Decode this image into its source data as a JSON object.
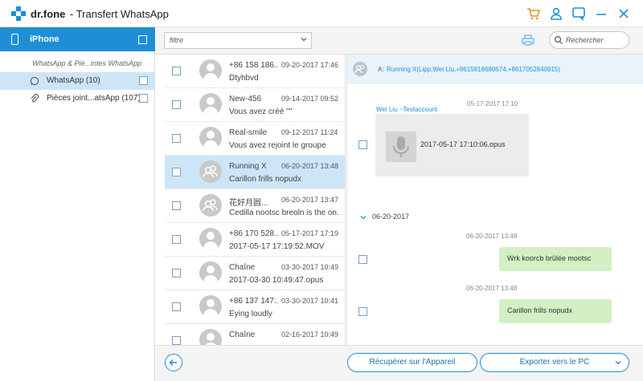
{
  "app": {
    "brand": "dr.fone",
    "title": "- Transfert WhatsApp"
  },
  "titlebar": {
    "icons": [
      "cart-icon",
      "user-icon",
      "feedback-icon",
      "minimize-icon",
      "close-icon"
    ]
  },
  "sidebar": {
    "device_name": "iPhone",
    "category_header": "WhatsApp & Piè...intes WhatsApp",
    "items": [
      {
        "label": "WhatsApp (10)",
        "icon": "whatsapp-icon",
        "selected": true
      },
      {
        "label": "Pièces joint...atsApp (107)",
        "icon": "paperclip-icon",
        "selected": false
      }
    ]
  },
  "toolbar": {
    "filter_value": "filtre",
    "search_placeholder": "Rechercher"
  },
  "conversations": [
    {
      "name": "+86 158 186...",
      "date": "09-20-2017 17:46",
      "preview": "Dtyhbvd",
      "selected": false,
      "group": false
    },
    {
      "name": "New-456",
      "date": "09-14-2017 09:52",
      "preview": "Vous avez créé \"\"",
      "selected": false,
      "group": false
    },
    {
      "name": "Real-smile",
      "date": "09-12-2017 11:24",
      "preview": "Vous avez rejoint le groupe",
      "selected": false,
      "group": false
    },
    {
      "name": "Running X",
      "date": "06-20-2017 13:48",
      "preview": "Carillon frills nopudx",
      "selected": true,
      "group": true
    },
    {
      "name": "花好月圆...",
      "date": "06-20-2017 13:47",
      "preview": "Cedilla nootsc breoln is the on...",
      "selected": false,
      "group": true
    },
    {
      "name": "+86 170 528...",
      "date": "05-17-2017 17:19",
      "preview": "2017-05-17 17:19:52.MOV",
      "selected": false,
      "group": false
    },
    {
      "name": "Chaîne",
      "date": "03-30-2017 10:49",
      "preview": "2017-03-30 10:49:47.opus",
      "selected": false,
      "group": false
    },
    {
      "name": "+86 137 147...",
      "date": "03-30-2017 10:41",
      "preview": "Eying loudly",
      "selected": false,
      "group": false
    },
    {
      "name": "Chaîne",
      "date": "02-16-2017 10:49",
      "preview": "",
      "selected": false,
      "group": false
    }
  ],
  "chat": {
    "to_label": "A:",
    "members": "Running X(Lipp,Wei Liu,+8615818680674,+8617052840915)",
    "first_time": "05-17-2017 17:10",
    "sender": "Wei Liu ~Testaccount",
    "attachment_name": "2017-05-17 17:10:06.opus",
    "date_separator": "06-20-2017",
    "messages": [
      {
        "time": "06-20-2017 13:48",
        "text": "Wrk koorcb brûlée mootsc"
      },
      {
        "time": "06-20-2017 13:48",
        "text": "Carillon frills nopudx"
      }
    ]
  },
  "bottom": {
    "restore_label": "Récupérer sur l'Appareil",
    "export_label": "Exporter vers le PC"
  },
  "colors": {
    "accent": "#1e8fd6",
    "selected_bg": "#cde6f7",
    "bubble": "#d2f0c3"
  }
}
